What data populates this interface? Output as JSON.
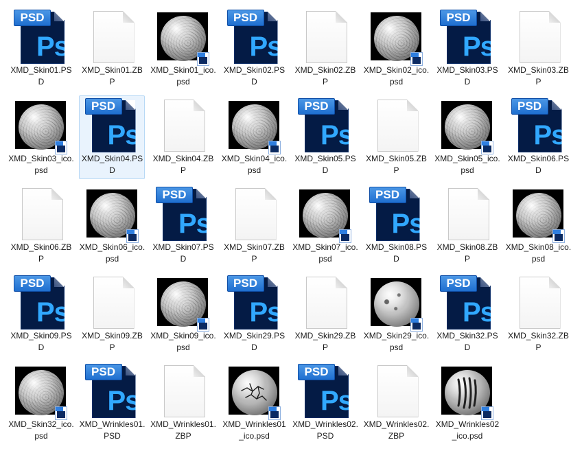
{
  "colors": {
    "selection_background": "#e9f3fd",
    "selection_border": "#b7d8f5",
    "psd_dark_blue": "#041b45",
    "psd_ps_blue": "#31a8ff",
    "psd_banner_blue": "#2f7fe0"
  },
  "icon_texts": {
    "psd_banner": "PSD",
    "psd_glyph": "Ps"
  },
  "files": [
    {
      "name": "XMD_Skin01.PSD",
      "type": "psd"
    },
    {
      "name": "XMD_Skin01.ZBP",
      "type": "zbp"
    },
    {
      "name": "XMD_Skin01_ico.psd",
      "type": "ico",
      "texture": "fine"
    },
    {
      "name": "XMD_Skin02.PSD",
      "type": "psd"
    },
    {
      "name": "XMD_Skin02.ZBP",
      "type": "zbp"
    },
    {
      "name": "XMD_Skin02_ico.psd",
      "type": "ico",
      "texture": "bumpy"
    },
    {
      "name": "XMD_Skin03.PSD",
      "type": "psd"
    },
    {
      "name": "XMD_Skin03.ZBP",
      "type": "zbp"
    },
    {
      "name": "XMD_Skin03_ico.psd",
      "type": "ico",
      "texture": "bumpy"
    },
    {
      "name": "XMD_Skin04.PSD",
      "type": "psd",
      "selected": true
    },
    {
      "name": "XMD_Skin04.ZBP",
      "type": "zbp"
    },
    {
      "name": "XMD_Skin04_ico.psd",
      "type": "ico",
      "texture": "bumpy"
    },
    {
      "name": "XMD_Skin05.PSD",
      "type": "psd"
    },
    {
      "name": "XMD_Skin05.ZBP",
      "type": "zbp"
    },
    {
      "name": "XMD_Skin05_ico.psd",
      "type": "ico",
      "texture": "bumpy"
    },
    {
      "name": "XMD_Skin06.PSD",
      "type": "psd"
    },
    {
      "name": "XMD_Skin06.ZBP",
      "type": "zbp"
    },
    {
      "name": "XMD_Skin06_ico.psd",
      "type": "ico",
      "texture": "bumpy"
    },
    {
      "name": "XMD_Skin07.PSD",
      "type": "psd"
    },
    {
      "name": "XMD_Skin07.ZBP",
      "type": "zbp"
    },
    {
      "name": "XMD_Skin07_ico.psd",
      "type": "ico",
      "texture": "fine"
    },
    {
      "name": "XMD_Skin08.PSD",
      "type": "psd"
    },
    {
      "name": "XMD_Skin08.ZBP",
      "type": "zbp"
    },
    {
      "name": "XMD_Skin08_ico.psd",
      "type": "ico",
      "texture": "fine"
    },
    {
      "name": "XMD_Skin09.PSD",
      "type": "psd"
    },
    {
      "name": "XMD_Skin09.ZBP",
      "type": "zbp"
    },
    {
      "name": "XMD_Skin09_ico.psd",
      "type": "ico",
      "texture": "bumpy"
    },
    {
      "name": "XMD_Skin29.PSD",
      "type": "psd"
    },
    {
      "name": "XMD_Skin29.ZBP",
      "type": "zbp"
    },
    {
      "name": "XMD_Skin29_ico.psd",
      "type": "ico",
      "texture": "pitted"
    },
    {
      "name": "XMD_Skin32.PSD",
      "type": "psd"
    },
    {
      "name": "XMD_Skin32.ZBP",
      "type": "zbp"
    },
    {
      "name": "XMD_Skin32_ico.psd",
      "type": "ico",
      "texture": "fine"
    },
    {
      "name": "XMD_Wrinkles01.PSD",
      "type": "psd"
    },
    {
      "name": "XMD_Wrinkles01.ZBP",
      "type": "zbp"
    },
    {
      "name": "XMD_Wrinkles01_ico.psd",
      "type": "ico",
      "texture": "cracks"
    },
    {
      "name": "XMD_Wrinkles02.PSD",
      "type": "psd"
    },
    {
      "name": "XMD_Wrinkles02.ZBP",
      "type": "zbp"
    },
    {
      "name": "XMD_Wrinkles02_ico.psd",
      "type": "ico",
      "texture": "grooves"
    }
  ]
}
